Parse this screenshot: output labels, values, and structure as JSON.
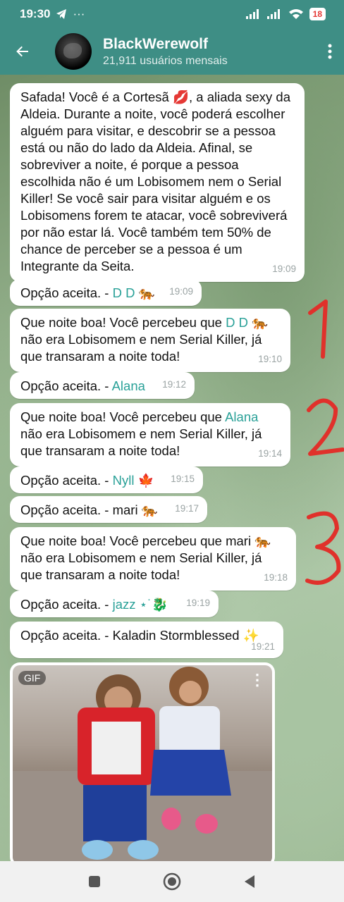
{
  "status": {
    "time": "19:30",
    "battery": "18"
  },
  "header": {
    "title": "BlackWerewolf",
    "subtitle": "21,911 usuários mensais"
  },
  "messages": [
    {
      "text": "Safada! Você é a Cortesã 💋, a aliada sexy da Aldeia. Durante a noite, você poderá escolher alguém para visitar, e descobrir se a pessoa está ou não do lado da Aldeia. Afinal, se sobreviver a noite, é porque a pessoa escolhida não é um Lobisomem nem o Serial Killer! Se você sair para visitar alguém e os Lobisomens forem te atacar, você sobreviverá por não estar lá. Você também tem 50% de chance de perceber se a pessoa é um Integrante da Seita.",
      "time": "19:09"
    },
    {
      "prefix": "Opção aceita. - ",
      "name": "D D 🐅",
      "time": "19:09"
    },
    {
      "prefix": "Que noite boa! Você percebeu que ",
      "name": "D D 🐅",
      "suffix": " não era Lobisomem e nem Serial Killer, já que transaram a noite toda!",
      "time": "19:10"
    },
    {
      "prefix": "Opção aceita. - ",
      "name": "Alana",
      "time": "19:12"
    },
    {
      "prefix": "Que noite boa! Você percebeu que ",
      "name": "Alana",
      "suffix": " não era Lobisomem e nem Serial Killer, já que transaram a noite toda!",
      "time": "19:14"
    },
    {
      "prefix": "Opção aceita. - ",
      "name": "Nyll 🍁",
      "time": "19:15"
    },
    {
      "prefix": "Opção aceita. - ",
      "name": "mari 🐅",
      "time": "19:17"
    },
    {
      "prefix": "Que noite boa! Você percebeu que ",
      "name": "mari 🐅",
      "suffix": " não era Lobisomem e nem Serial Killer, já que transaram a noite toda!",
      "time": "19:18"
    },
    {
      "prefix": "Opção aceita. - ",
      "name": "jazz ⋆˙🐉",
      "time": "19:19"
    },
    {
      "prefix": "Opção aceita. - ",
      "name": "Kaladin Stormblessed ✨",
      "time": "19:21"
    }
  ],
  "gif": {
    "badge": "GIF"
  },
  "annotations": [
    "1",
    "2",
    "3"
  ],
  "colors": {
    "header": "#3e8e85",
    "name": "#2aa198",
    "annotation": "#e0312b"
  }
}
